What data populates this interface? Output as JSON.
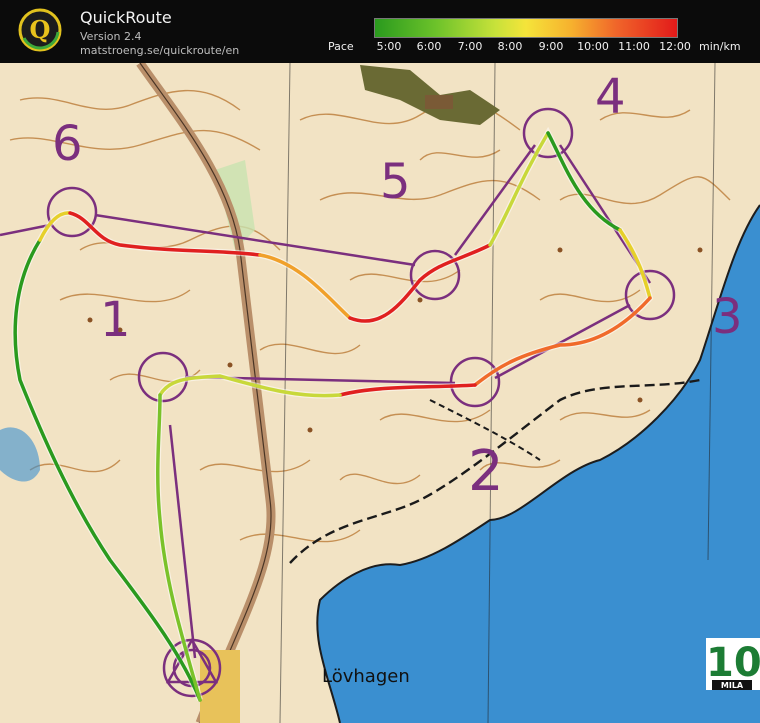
{
  "app": {
    "logo_letter": "Q",
    "title": "QuickRoute",
    "version": "Version 2.4",
    "url": "matstroeng.se/quickroute/en"
  },
  "pace_legend": {
    "label": "Pace",
    "ticks": [
      "5:00",
      "6:00",
      "7:00",
      "8:00",
      "9:00",
      "10:00",
      "11:00",
      "12:00"
    ],
    "unit": "min/km",
    "gradient_colors": [
      "#2a9a1e",
      "#6cc22a",
      "#c8e23a",
      "#f5e43a",
      "#f6b12e",
      "#f0652a",
      "#e21a1a"
    ]
  },
  "map": {
    "place_label": "Lövhagen",
    "controls": [
      "1",
      "2",
      "3",
      "4",
      "5",
      "6"
    ],
    "badge_number": "10",
    "badge_text": "MILA",
    "colors": {
      "terrain": "#f2e3c4",
      "contour": "#b7742e",
      "water": "#3a8fd0",
      "course": "#7b2f7e",
      "route_slow": "#e02020",
      "route_fast": "#2a9a1e"
    }
  }
}
